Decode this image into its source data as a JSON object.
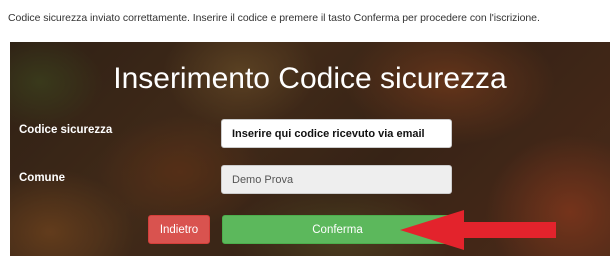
{
  "notice": "Codice sicurezza inviato correttamente. Inserire il codice e premere il tasto Conferma per procedere con l'iscrizione.",
  "panel": {
    "title": "Inserimento Codice sicurezza"
  },
  "form": {
    "code_label": "Codice sicurezza",
    "code_value": "Inserire qui codice ricevuto via email",
    "comune_label": "Comune",
    "comune_value": "Demo Prova"
  },
  "buttons": {
    "back_label": "Indietro",
    "confirm_label": "Conferma"
  },
  "colors": {
    "back_button": "#d9534f",
    "confirm_button": "#5cb85c",
    "annotation_arrow": "#e3232c"
  },
  "icons": {
    "annotation": "red-arrow-icon"
  }
}
